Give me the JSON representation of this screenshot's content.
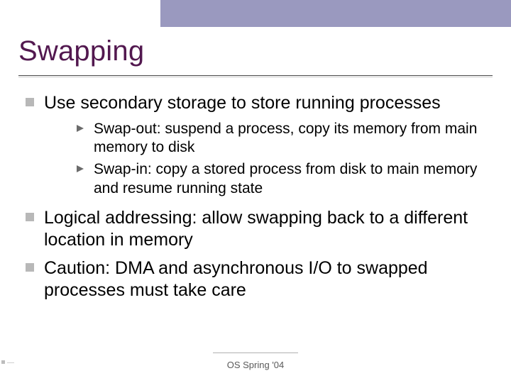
{
  "title": "Swapping",
  "bullets": [
    {
      "text": "Use secondary storage to store running processes",
      "sub": [
        "Swap-out: suspend a process, copy its  memory from main memory to disk",
        "Swap-in: copy a stored process from disk to main memory and resume running state"
      ]
    },
    {
      "text": "Logical addressing: allow swapping back to a different location in memory",
      "sub": []
    },
    {
      "text": "Caution: DMA and asynchronous I/O to swapped processes must take care",
      "sub": []
    }
  ],
  "footer": "OS Spring '04"
}
